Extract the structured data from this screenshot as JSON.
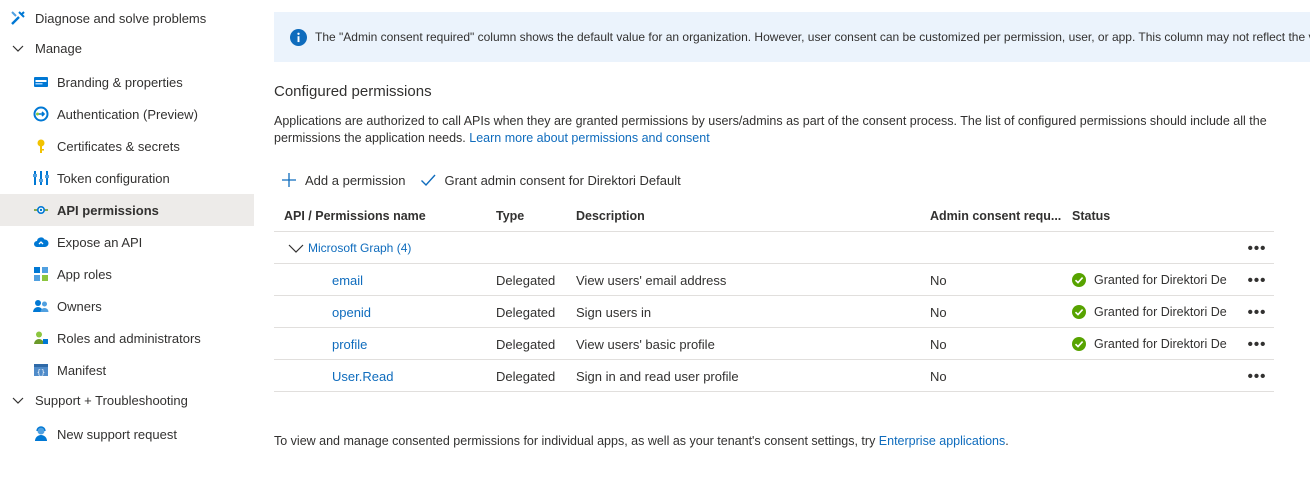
{
  "sidebar": {
    "diagnose": {
      "label": "Diagnose and solve problems",
      "icon": "wrench-icon"
    },
    "manage": {
      "label": "Manage",
      "icon": "chevron-down-icon"
    },
    "items": [
      {
        "label": "Branding & properties",
        "icon": "branding-icon"
      },
      {
        "label": "Authentication (Preview)",
        "icon": "authentication-icon"
      },
      {
        "label": "Certificates & secrets",
        "icon": "key-icon"
      },
      {
        "label": "Token configuration",
        "icon": "token-config-icon"
      },
      {
        "label": "API permissions",
        "icon": "api-permissions-icon",
        "selected": true
      },
      {
        "label": "Expose an API",
        "icon": "cloud-icon"
      },
      {
        "label": "App roles",
        "icon": "app-roles-icon"
      },
      {
        "label": "Owners",
        "icon": "owners-icon"
      },
      {
        "label": "Roles and administrators",
        "icon": "roles-admin-icon"
      },
      {
        "label": "Manifest",
        "icon": "manifest-icon"
      }
    ],
    "support": {
      "label": "Support + Troubleshooting",
      "icon": "chevron-down-icon"
    },
    "support_items": [
      {
        "label": "New support request",
        "icon": "support-person-icon"
      }
    ]
  },
  "info_bar": {
    "icon": "info-icon",
    "text": "The \"Admin consent required\" column shows the default value for an organization. However, user consent can be customized per permission, user, or app. This column may not reflect the v"
  },
  "section": {
    "title": "Configured permissions",
    "desc_prefix": "Applications are authorized to call APIs when they are granted permissions by users/admins as part of the consent process. The list of configured permissions should include all the permissions the application needs.",
    "desc_link": "Learn more about permissions and consent"
  },
  "commands": {
    "add": "Add a permission",
    "grant": "Grant admin consent for Direktori Default"
  },
  "table": {
    "headers": [
      "API / Permissions name",
      "Type",
      "Description",
      "Admin consent requ...",
      "Status"
    ],
    "group": {
      "label": "Microsoft Graph (4)",
      "more": "•••"
    },
    "rows": [
      {
        "name": "email",
        "type": "Delegated",
        "description": "View users' email address",
        "admin": "No",
        "status": "Granted for Direktori De",
        "more": "•••"
      },
      {
        "name": "openid",
        "type": "Delegated",
        "description": "Sign users in",
        "admin": "No",
        "status": "Granted for Direktori De",
        "more": "•••"
      },
      {
        "name": "profile",
        "type": "Delegated",
        "description": "View users' basic profile",
        "admin": "No",
        "status": "Granted for Direktori De",
        "more": "•••"
      },
      {
        "name": "User.Read",
        "type": "Delegated",
        "description": "Sign in and read user profile",
        "admin": "No",
        "status": "",
        "more": "•••"
      }
    ]
  },
  "footer": {
    "prefix": "To view and manage consented permissions for individual apps, as well as your tenant's consent settings, try ",
    "link": "Enterprise applications",
    "suffix": "."
  },
  "colors": {
    "accent": "#0f6cbd",
    "success": "#57a300",
    "info_bg": "#ebf3fc",
    "selected_bg": "#edebe9"
  }
}
